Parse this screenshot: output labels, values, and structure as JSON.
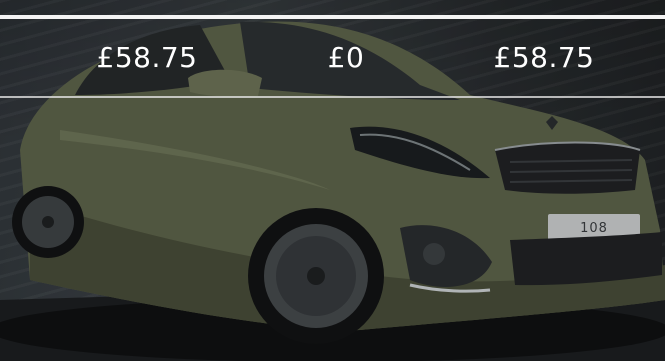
{
  "prices": {
    "first": "£58.75",
    "second": "£0",
    "third": "£58.75"
  },
  "car": {
    "badge_text": "108"
  },
  "colors": {
    "car_body": "#6a7055",
    "background_dark": "#1b1d1f",
    "text": "#ffffff"
  }
}
